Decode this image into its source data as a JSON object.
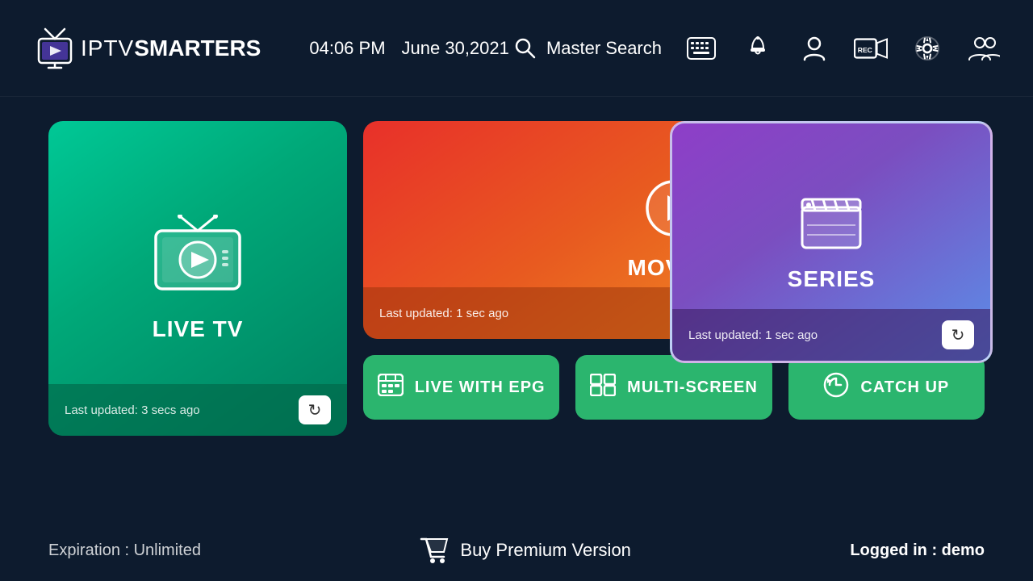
{
  "header": {
    "logo_iptv": "IPTV",
    "logo_smarters": "SMARTERS",
    "time": "04:06 PM",
    "date": "June 30,2021",
    "search_label": "Master Search",
    "icons": {
      "keyboard": "⌨",
      "bell": "🔔",
      "profile": "👤",
      "record": "⏺",
      "settings": "⚙",
      "multiprofile": "👥"
    }
  },
  "cards": {
    "live_tv": {
      "label": "LIVE TV",
      "footer": "Last updated: 3 secs ago",
      "refresh_label": "↻"
    },
    "movies": {
      "label": "MOVIES",
      "footer": "Last updated: 1 sec ago",
      "refresh_label": "↻"
    },
    "series": {
      "label": "SERIES",
      "footer": "Last updated: 1 sec ago",
      "refresh_label": "↻"
    }
  },
  "buttons": {
    "live_with_epg": "LIVE WITH EPG",
    "multi_screen": "MULTI-SCREEN",
    "catch_up": "CATCH UP"
  },
  "footer": {
    "expiration_label": "Expiration : Unlimited",
    "buy_premium_label": "Buy Premium Version",
    "logged_in_label": "Logged in : ",
    "username": "demo"
  }
}
